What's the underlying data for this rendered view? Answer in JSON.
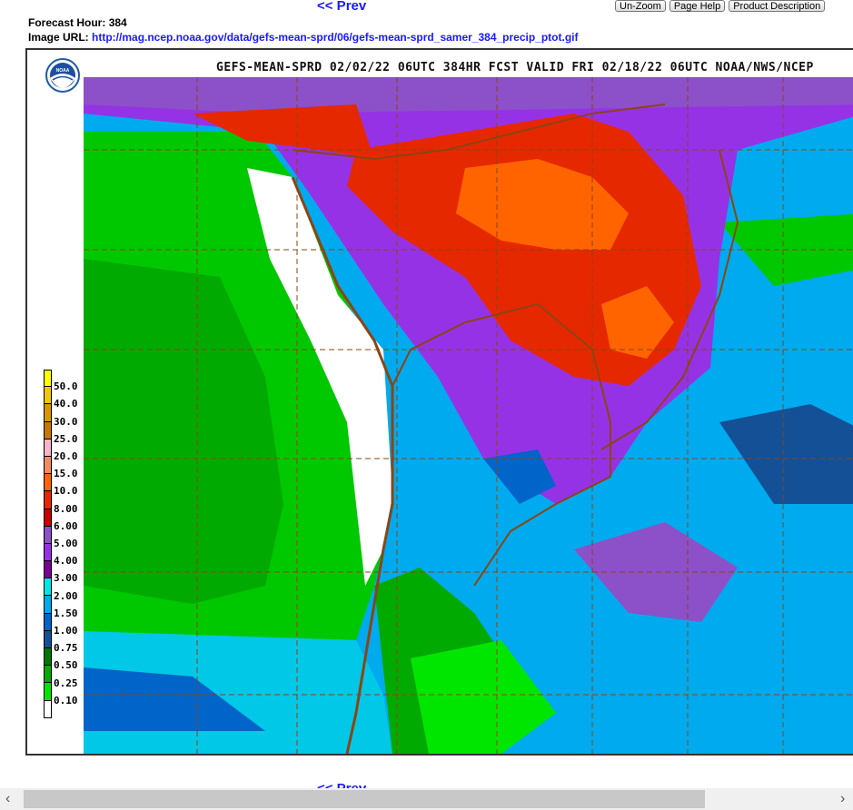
{
  "nav": {
    "prev_top": "<< Prev",
    "prev_bottom": "<< Prev"
  },
  "buttons": {
    "unzoom": "Un-Zoom",
    "help": "Page Help",
    "desc": "Product Description"
  },
  "meta": {
    "forecast_label": "Forecast Hour:",
    "forecast_value": "384",
    "url_label": "Image URL:",
    "url": "http://mag.ncep.noaa.gov/data/gefs-mean-sprd/06/gefs-mean-sprd_samer_384_precip_ptot.gif"
  },
  "map": {
    "title": "GEFS-MEAN-SPRD 02/02/22 06UTC 384HR FCST VALID FRI 02/18/22 06UTC NOAA/NWS/NCEP",
    "logo_text": "NOAA"
  },
  "legend": {
    "labels": [
      "50.0",
      "40.0",
      "30.0",
      "25.0",
      "20.0",
      "15.0",
      "10.0",
      "8.00",
      "6.00",
      "5.00",
      "4.00",
      "3.00",
      "2.00",
      "1.50",
      "1.00",
      "0.75",
      "0.50",
      "0.25",
      "0.10"
    ],
    "colors": [
      "#ffff00",
      "#f0c800",
      "#d89600",
      "#c87800",
      "#f8b4c8",
      "#f08c64",
      "#ff6400",
      "#e62800",
      "#c80000",
      "#8c50c8",
      "#9632e6",
      "#780096",
      "#00e6e6",
      "#00aaee",
      "#0064c8",
      "#145096",
      "#007800",
      "#00aa00",
      "#00e600",
      "#ffffff"
    ]
  },
  "scroll": {
    "left_arrow": "‹",
    "right_arrow": "›"
  }
}
